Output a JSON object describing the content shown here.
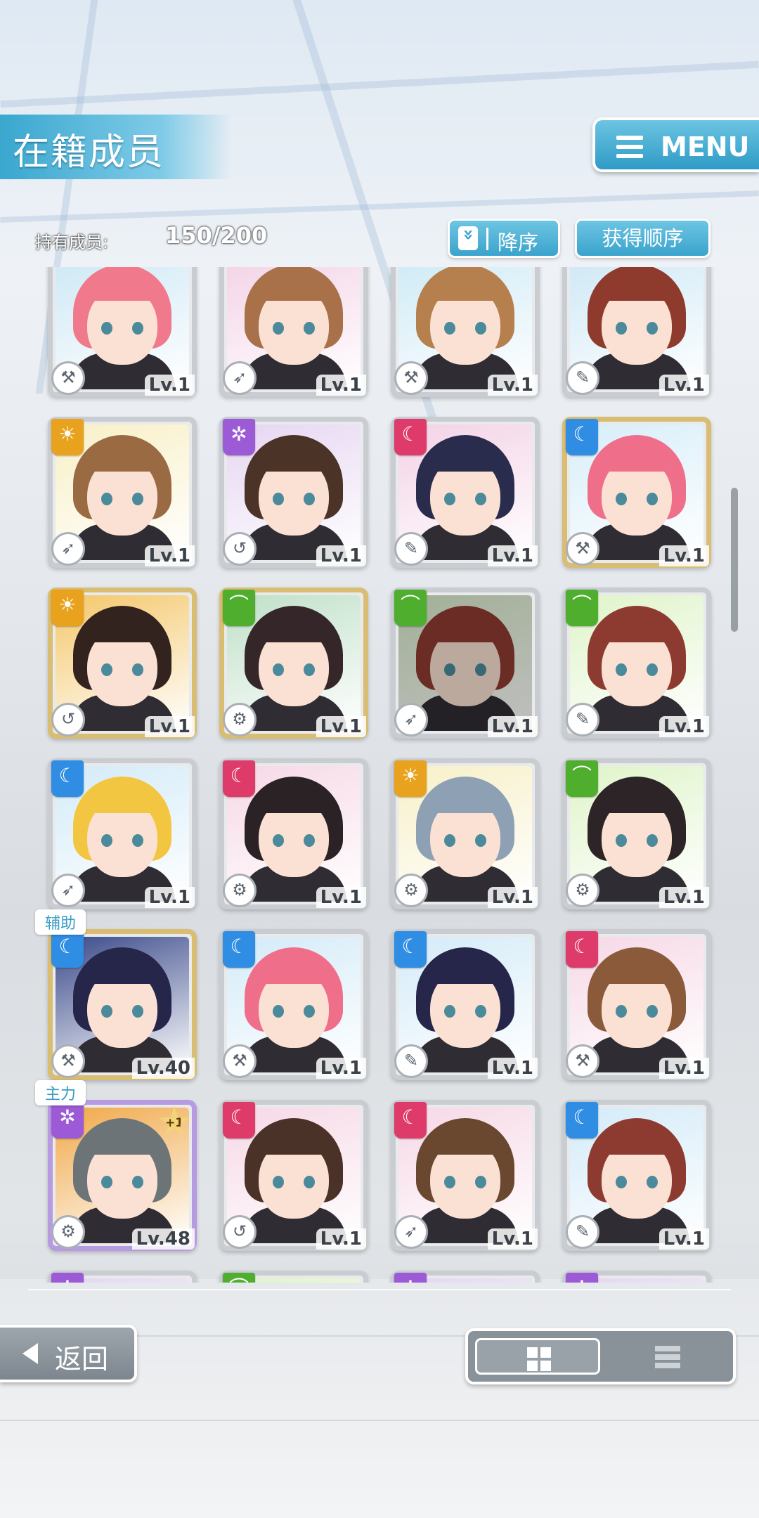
{
  "header": {
    "title": "在籍成员",
    "menu_label": "MENU",
    "member_count_label": "持有成员:",
    "member_count_value": "150/200",
    "sort_direction_label": "降序",
    "sort_order_label": "获得顺序"
  },
  "colors": {
    "accent": "#3aa3cc",
    "attr_orange": "#e9a21d",
    "attr_purple": "#9d5ad6",
    "attr_pink": "#df3b6a",
    "attr_blue": "#2f8de3",
    "attr_green": "#4fae2d"
  },
  "rows": [
    {
      "members": [
        {
          "lv": "Lv.1",
          "attr": "",
          "hair": "#f07a8c",
          "bg": "#cde8f5",
          "role": "hammer-icon"
        },
        {
          "lv": "Lv.1",
          "attr": "",
          "hair": "#a8714a",
          "bg": "#f3d2e6",
          "role": "rocket-icon"
        },
        {
          "lv": "Lv.1",
          "attr": "",
          "hair": "#b6804e",
          "bg": "#cdeaf6",
          "role": "hammer-icon"
        },
        {
          "lv": "Lv.1",
          "attr": "",
          "hair": "#8e3a2c",
          "bg": "#cde8f5",
          "role": "wrench-icon"
        }
      ]
    },
    {
      "members": [
        {
          "lv": "Lv.1",
          "attr": "orange",
          "hair": "#9a6a43",
          "bg": "#f8f0c6",
          "role": "rocket-icon"
        },
        {
          "lv": "Lv.1",
          "attr": "purple",
          "hair": "#4b3327",
          "bg": "#e6d6f2",
          "role": "boomerang-icon"
        },
        {
          "lv": "Lv.1",
          "attr": "pink",
          "hair": "#2a2c4e",
          "bg": "#f3d2e6",
          "role": "wrench-icon"
        },
        {
          "lv": "Lv.1",
          "attr": "blue",
          "hair": "#ef6f8a",
          "bg": "#d7eef9",
          "role": "hammer-icon",
          "frame": "gold"
        }
      ]
    },
    {
      "members": [
        {
          "lv": "Lv.1",
          "attr": "orange",
          "hair": "#32231f",
          "bg": "#f4c76a",
          "role": "boomerang-icon",
          "frame": "gold"
        },
        {
          "lv": "Lv.1",
          "attr": "green",
          "hair": "#35262a",
          "bg": "#bfe0c8",
          "role": "gear-icon",
          "frame": "gold"
        },
        {
          "lv": "Lv.1",
          "attr": "green",
          "hair": "#8d3b30",
          "bg": "#d8ebc8",
          "role": "rocket-icon",
          "dim": true
        },
        {
          "lv": "Lv.1",
          "attr": "green",
          "hair": "#8d3b30",
          "bg": "#dff4c9",
          "role": "wrench-icon"
        }
      ]
    },
    {
      "members": [
        {
          "lv": "Lv.1",
          "attr": "blue",
          "hair": "#f2c640",
          "bg": "#d3ebf8",
          "role": "rocket-icon"
        },
        {
          "lv": "Lv.1",
          "attr": "pink",
          "hair": "#2b2226",
          "bg": "#f6d8e6",
          "role": "gear-icon"
        },
        {
          "lv": "Lv.1",
          "attr": "orange",
          "hair": "#8ea0b3",
          "bg": "#f7f0c8",
          "role": "gear-icon"
        },
        {
          "lv": "Lv.1",
          "attr": "green",
          "hair": "#2c2426",
          "bg": "#dff4c9",
          "role": "gear-icon"
        }
      ]
    },
    {
      "members": [
        {
          "lv": "Lv.40",
          "attr": "blue",
          "hair": "#26254a",
          "bg": "#3a4a8a",
          "role": "hammer-icon",
          "frame": "gold",
          "tag": "辅助"
        },
        {
          "lv": "Lv.1",
          "attr": "blue",
          "hair": "#ef6f8a",
          "bg": "#d3ebf8",
          "role": "hammer-icon"
        },
        {
          "lv": "Lv.1",
          "attr": "blue",
          "hair": "#26254a",
          "bg": "#d3ebf8",
          "role": "wrench-icon"
        },
        {
          "lv": "Lv.1",
          "attr": "pink",
          "hair": "#8a5a3a",
          "bg": "#f6d8e6",
          "role": "hammer-icon"
        }
      ]
    },
    {
      "members": [
        {
          "lv": "Lv.48",
          "attr": "purple",
          "hair": "#6d7478",
          "bg": "#f0a848",
          "role": "gear-icon",
          "frame": "rainbow",
          "tag": "主力",
          "plus": "+1"
        },
        {
          "lv": "Lv.1",
          "attr": "pink",
          "hair": "#4a3228",
          "bg": "#f6d8e6",
          "role": "boomerang-icon"
        },
        {
          "lv": "Lv.1",
          "attr": "pink",
          "hair": "#6a4830",
          "bg": "#f6d8e6",
          "role": "rocket-icon"
        },
        {
          "lv": "Lv.1",
          "attr": "blue",
          "hair": "#8d3b30",
          "bg": "#d3ebf8",
          "role": "wrench-icon"
        }
      ]
    },
    {
      "members": [
        {
          "lv": "",
          "attr": "purple",
          "hair": "#6a4a3a",
          "bg": "#e6d6f2",
          "role": ""
        },
        {
          "lv": "",
          "attr": "green",
          "hair": "#e9c04a",
          "bg": "#dff4c9",
          "role": ""
        },
        {
          "lv": "",
          "attr": "purple",
          "hair": "#6a4830",
          "bg": "#e6d6f2",
          "role": ""
        },
        {
          "lv": "",
          "attr": "purple",
          "hair": "#6a4830",
          "bg": "#e6d6f2",
          "role": ""
        }
      ]
    }
  ],
  "footer": {
    "back_label": "返回",
    "view_mode_selected": "grid"
  }
}
